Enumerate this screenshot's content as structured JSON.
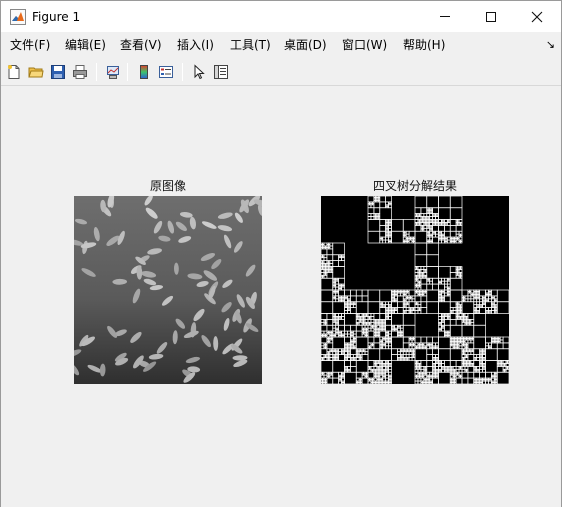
{
  "window": {
    "title": "Figure 1",
    "icon": "matlab-figure-icon"
  },
  "menu": {
    "items": [
      "文件(F)",
      "编辑(E)",
      "查看(V)",
      "插入(I)",
      "工具(T)",
      "桌面(D)",
      "窗口(W)",
      "帮助(H)"
    ],
    "dock_arrow": "↘"
  },
  "toolbar": {
    "buttons": [
      "new-figure-icon",
      "open-file-icon",
      "save-icon",
      "print-icon",
      "link-plot-icon",
      "insert-colorbar-icon",
      "insert-legend-icon",
      "edit-plot-icon",
      "property-inspector-icon"
    ]
  },
  "figure": {
    "left_title": "原图像",
    "right_title": "四叉树分解结果"
  },
  "colors": {
    "titlebar_bg": "#ffffff",
    "figure_bg": "#f0f0f0",
    "image_dark": "#3a3a3a",
    "grain_light": "#c8c8c8",
    "quadtree_bg": "#000000",
    "quadtree_line": "#ffffff"
  }
}
